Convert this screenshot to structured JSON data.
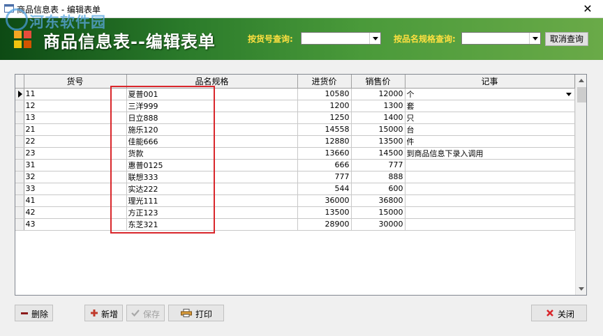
{
  "window": {
    "title": "商品信息表 - 编辑表单",
    "close_glyph": "✕"
  },
  "watermark": {
    "text": "河东软件园"
  },
  "header": {
    "title": "商品信息表--编辑表单",
    "query_by_id_label": "按货号查询:",
    "query_by_spec_label": "按品名规格查询:",
    "query_by_id_value": "",
    "query_by_spec_value": "",
    "cancel_query_label": "取消查询"
  },
  "table": {
    "columns": [
      "货号",
      "品名规格",
      "进货价",
      "销售价",
      "记事"
    ],
    "rows": [
      {
        "id": "11",
        "spec": "夏普001",
        "cost": "10580",
        "sale": "12000",
        "note": "个"
      },
      {
        "id": "12",
        "spec": "三洋999",
        "cost": "1200",
        "sale": "1300",
        "note": "套"
      },
      {
        "id": "13",
        "spec": "日立888",
        "cost": "1250",
        "sale": "1400",
        "note": "只"
      },
      {
        "id": "21",
        "spec": "施乐120",
        "cost": "14558",
        "sale": "15000",
        "note": "台"
      },
      {
        "id": "22",
        "spec": "佳能666",
        "cost": "12880",
        "sale": "13500",
        "note": "件"
      },
      {
        "id": "23",
        "spec": "货款",
        "cost": "13660",
        "sale": "14500",
        "note": "到商品信息下录入调用"
      },
      {
        "id": "31",
        "spec": "惠普0125",
        "cost": "666",
        "sale": "777",
        "note": ""
      },
      {
        "id": "32",
        "spec": "联想333",
        "cost": "777",
        "sale": "888",
        "note": ""
      },
      {
        "id": "33",
        "spec": "实达222",
        "cost": "544",
        "sale": "600",
        "note": ""
      },
      {
        "id": "41",
        "spec": "理光111",
        "cost": "36000",
        "sale": "36800",
        "note": ""
      },
      {
        "id": "42",
        "spec": "方正123",
        "cost": "13500",
        "sale": "15000",
        "note": ""
      },
      {
        "id": "43",
        "spec": "东芝321",
        "cost": "28900",
        "sale": "30000",
        "note": ""
      }
    ]
  },
  "toolbar": {
    "delete_label": "删除",
    "add_label": "新增",
    "save_label": "保存",
    "print_label": "打印",
    "close_label": "关闭"
  },
  "icons": {
    "delete": "minus-icon",
    "add": "plus-icon",
    "save": "check-icon",
    "print": "printer-icon",
    "close": "red-x-icon"
  },
  "colors": {
    "header_dark": "#0d4a14",
    "header_light": "#6aaa48",
    "query_label": "#ffe040",
    "highlight_border": "#d9262b",
    "delete_icon": "#8b1a1a",
    "add_icon": "#c0392b",
    "close_icon": "#d9262b"
  }
}
